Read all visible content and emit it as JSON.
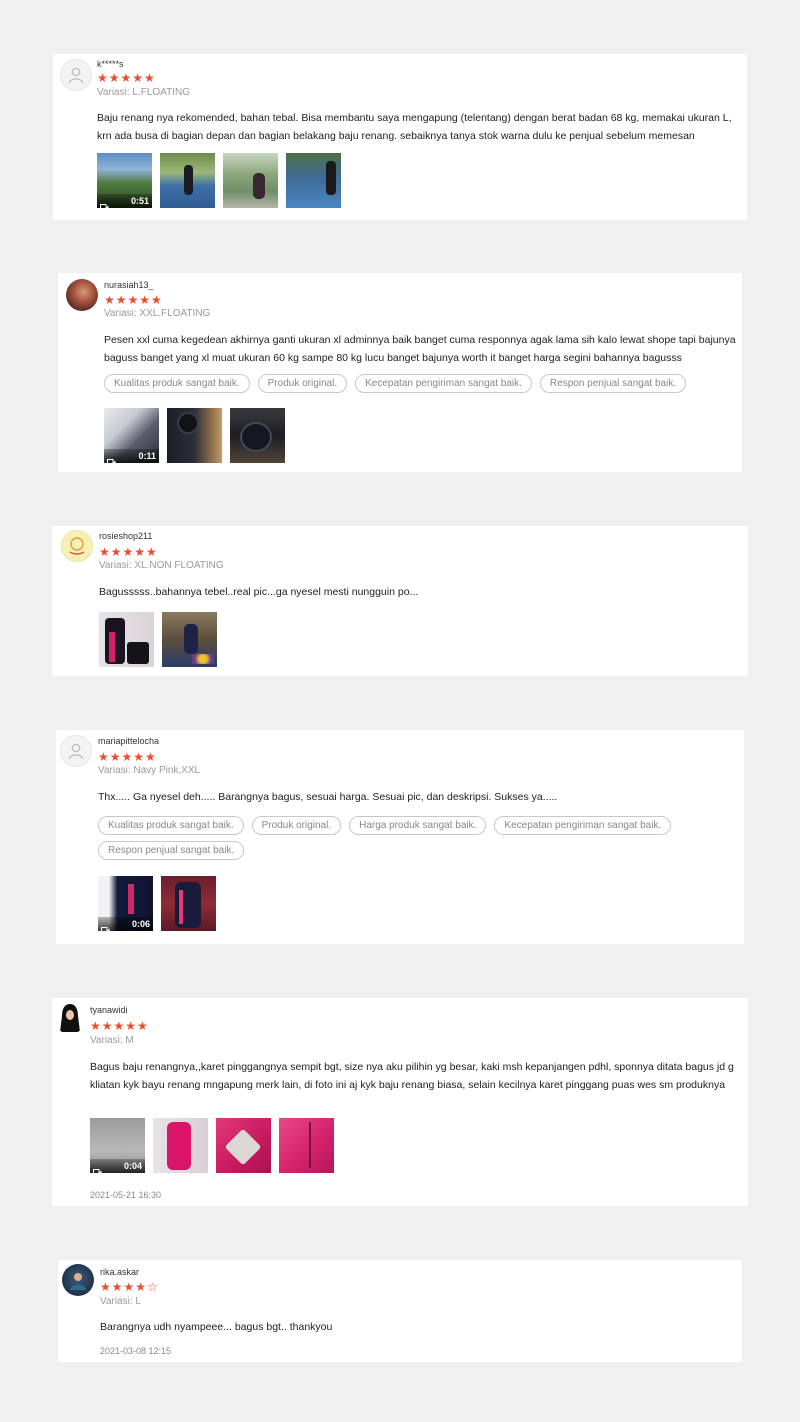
{
  "reviews": [
    {
      "username": "k*****s",
      "rating": 5,
      "stars": "★★★★★",
      "variant": "Variasi: L.FLOATING",
      "comment": "Baju renang nya rekomended, bahan tebal. Bisa membantu saya mengapung (telentang) dengan berat badan 68 kg, memakai ukuran L, krn ada busa di bagian depan dan bagian belakang baju renang. sebaiknya tanya stok warna dulu ke penjual sebelum memesan",
      "tags": [],
      "video_duration": "0:51",
      "media_count": 4,
      "date": ""
    },
    {
      "username": "nurasiah13_",
      "rating": 5,
      "stars": "★★★★★",
      "variant": "Variasi: XXL.FLOATING",
      "comment": "Pesen xxl cuma kegedean akhirnya ganti ukuran xl adminnya baik banget cuma responnya agak lama sih kalo lewat shope tapi bajunya baguss banget yang xl muat ukuran 60 kg sampe 80 kg lucu banget bajunya worth it banget harga segini bahannya bagusss",
      "tags": [
        "Kualitas produk sangat baik.",
        "Produk original.",
        "Kecepatan pengiriman sangat baik.",
        "Respon penjual sangat baik."
      ],
      "video_duration": "0:11",
      "media_count": 3,
      "date": ""
    },
    {
      "username": "rosieshop211",
      "rating": 5,
      "stars": "★★★★★",
      "variant": "Variasi: XL.NON FLOATING",
      "comment": "Bagusssss..bahannya tebel..real pic...ga nyesel mesti nungguin po...",
      "tags": [],
      "video_duration": "",
      "media_count": 2,
      "date": ""
    },
    {
      "username": "mariapittelocha",
      "rating": 5,
      "stars": "★★★★★",
      "variant": "Variasi: Navy Pink,XXL",
      "comment": "Thx..... Ga nyesel deh..... Barangnya bagus, sesuai harga. Sesuai pic, dan deskripsi. Sukses ya.....",
      "tags": [
        "Kualitas produk sangat baik.",
        "Produk original.",
        "Harga produk sangat baik.",
        "Kecepatan pengiriman sangat baik.",
        "Respon penjual sangat baik."
      ],
      "video_duration": "0:06",
      "media_count": 2,
      "date": ""
    },
    {
      "username": "tyanawidi",
      "rating": 5,
      "stars": "★★★★★",
      "variant": "Variasi: M",
      "comment": "Bagus baju renangnya,,karet pinggangnya sempit bgt, size nya aku pilihin yg besar, kaki msh kepanjangen pdhl, sponnya ditata bagus jd g kliatan kyk bayu renang mngapung merk lain, di foto ini aj kyk baju renang biasa, selain kecilnya karet pinggang puas wes sm produknya",
      "tags": [],
      "video_duration": "0:04",
      "media_count": 4,
      "date": "2021-05-21 16:30"
    },
    {
      "username": "rika.askar",
      "rating": 4,
      "stars": "★★★★☆",
      "variant": "Variasi: L",
      "comment": "Barangnya udh nyampeee... bagus bgt.. thankyou",
      "tags": [],
      "video_duration": "",
      "media_count": 0,
      "date": "2021-03-08 12:15"
    }
  ],
  "colors": {
    "star": "#ee4d2d",
    "background": "#f0f0f0",
    "card": "#ffffff"
  },
  "icons": {
    "default_avatar": "user-silhouette-icon",
    "video": "video-camera-icon"
  }
}
